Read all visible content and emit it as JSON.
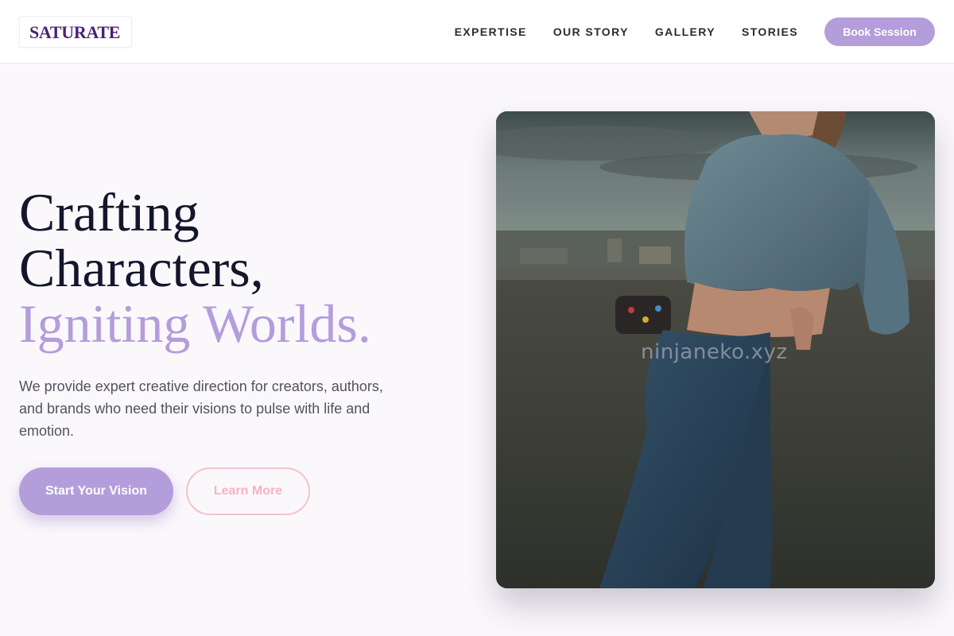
{
  "header": {
    "logo": "SATURATE",
    "nav": [
      "EXPERTISE",
      "OUR STORY",
      "GALLERY",
      "STORIES"
    ],
    "cta": "Book Session"
  },
  "hero": {
    "title_line1": "Crafting",
    "title_line2": "Characters,",
    "title_line3": "Igniting Worlds.",
    "subtitle": "We provide expert creative direction for creators, authors, and brands who need their visions to pulse with life and emotion.",
    "primary_button": "Start Your Vision",
    "secondary_button": "Learn More",
    "image_watermark": "ninjaneko.xyz"
  },
  "colors": {
    "brand": "#4b1f7a",
    "accent": "#b39ddb",
    "outline_pink": "#f5c1cc",
    "heading": "#14172b"
  }
}
